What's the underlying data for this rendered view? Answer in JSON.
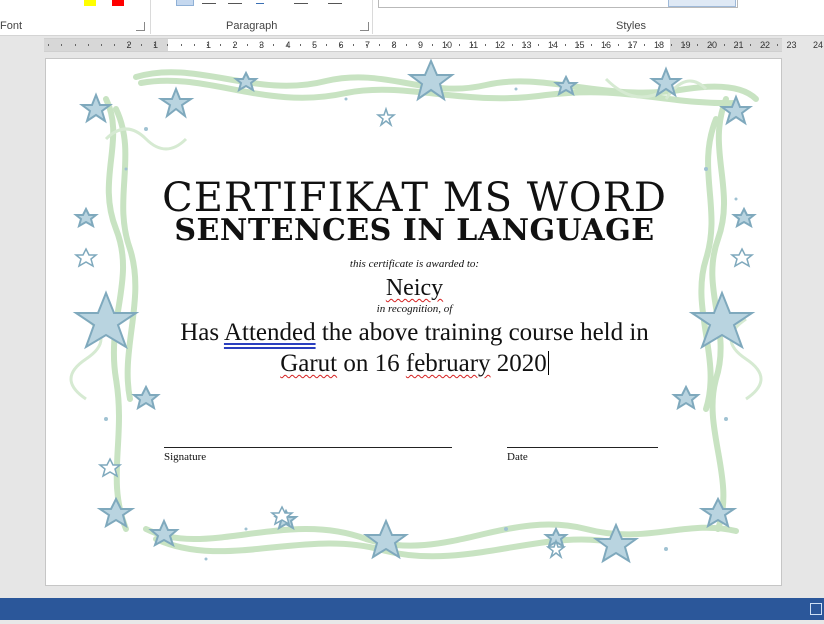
{
  "ribbon": {
    "groups": [
      {
        "label": "Font"
      },
      {
        "label": "Paragraph"
      },
      {
        "label": "Styles"
      }
    ],
    "colors": {
      "highlight": "#ffff00",
      "font_color": "#ff0000",
      "accent": "#2b579a"
    }
  },
  "ruler": {
    "labels": [
      "2",
      "1",
      "1",
      "2",
      "3",
      "4",
      "5",
      "6",
      "7",
      "8",
      "9",
      "10",
      "11",
      "12",
      "13",
      "14",
      "15",
      "16",
      "17",
      "18",
      "19",
      "20",
      "21",
      "22",
      "23",
      "24",
      "25"
    ]
  },
  "certificate": {
    "title": "CERTIFIKAT MS WORD",
    "subtitle": "SENTENCES IN LANGUAGE",
    "awarded_to": "this certificate is awarded to:",
    "recipient": "Neicy",
    "recognition": "in recognition, of",
    "body_line1_a": "Has ",
    "body_line1_b": "Attended",
    "body_line1_c": " the above training course held in",
    "body_line2_a": "Garut",
    "body_line2_b": " on 16 ",
    "body_line2_c": "february",
    "body_line2_d": " 2020",
    "signature_label": "Signature",
    "date_label": "Date"
  },
  "decor": {
    "border_color": "#c8e3c2",
    "star_color": "#7fa9bd"
  }
}
